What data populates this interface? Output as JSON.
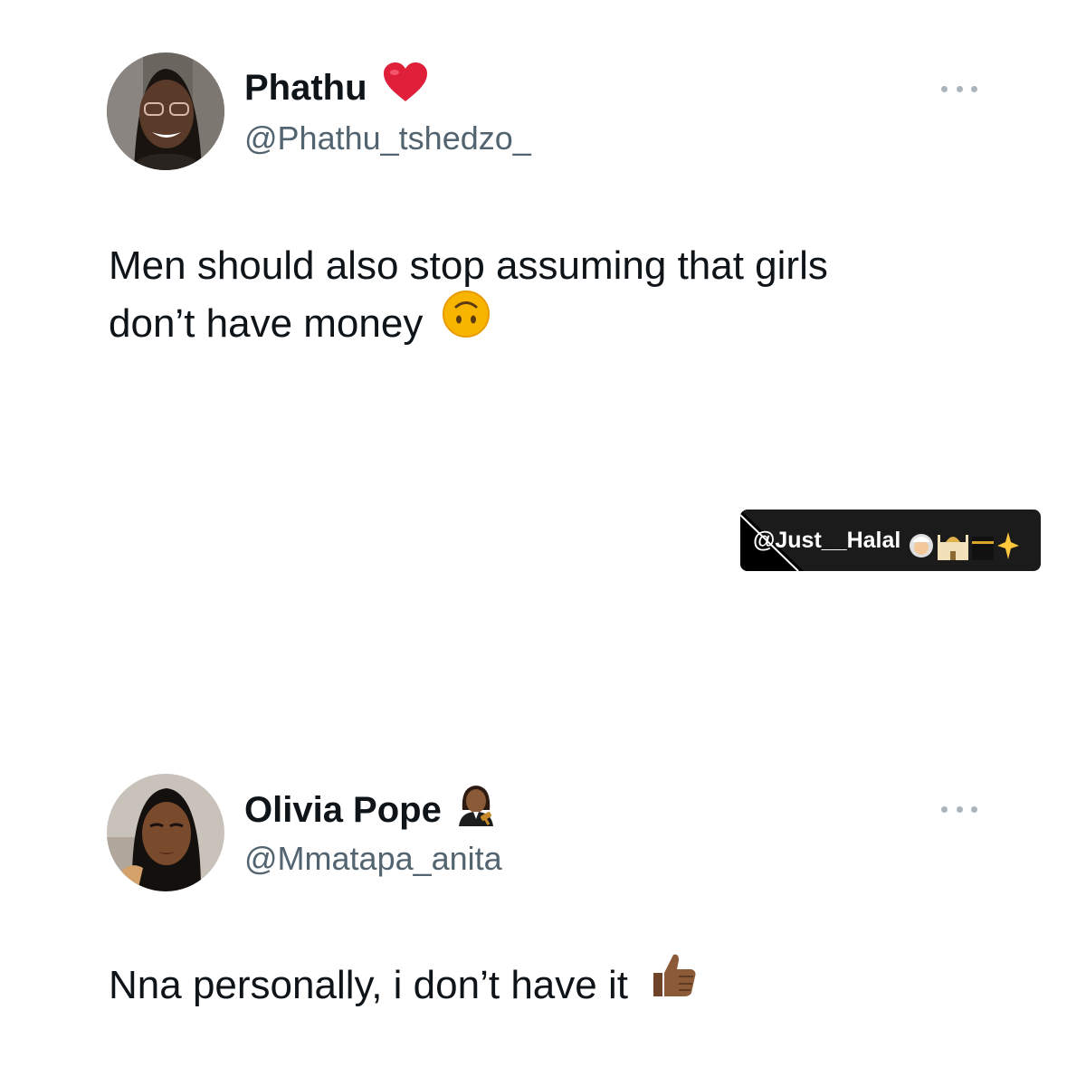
{
  "tweets": [
    {
      "display_name": "Phathu",
      "name_emoji": "heart-icon",
      "handle": "@Phathu_tshedzo_",
      "text_line1": "Men should also stop assuming that girls",
      "text_line2": "don’t have money",
      "text_emoji": "upside-down-face-icon"
    },
    {
      "display_name": "Olivia Pope",
      "name_emoji": "woman-judge-icon",
      "handle": "@Mmatapa_anita",
      "text": "Nna personally, i don’t have it",
      "text_emoji": "thumbs-up-icon"
    }
  ],
  "watermark": {
    "text": "@Just__Halal",
    "emojis": [
      "person-icon",
      "mosque-icon",
      "kaaba-icon",
      "sparkle-icon"
    ]
  },
  "colors": {
    "text": "#0f1419",
    "handle": "#536471",
    "more_dots": "#aab4bc",
    "heart": "#e0203a",
    "watermark_bg": "#1b1b1b"
  }
}
